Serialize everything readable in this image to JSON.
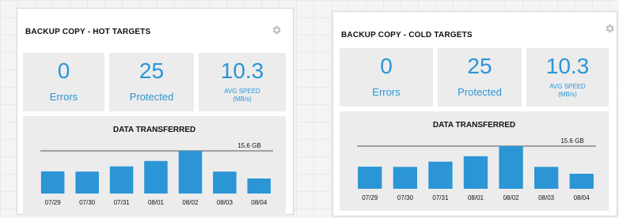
{
  "panels": [
    {
      "title": "BACKUP COPY - HOT TARGETS",
      "stats": {
        "errors": {
          "value": "0",
          "label": "Errors"
        },
        "protected": {
          "value": "25",
          "label": "Protected"
        },
        "speed": {
          "value": "10.3",
          "label_line1": "AVG SPEED",
          "label_line2": "(MB/s)"
        }
      },
      "chart_data": {
        "type": "bar",
        "title": "DATA TRANSFERRED",
        "categories": [
          "07/29",
          "07/30",
          "07/31",
          "08/01",
          "08/02",
          "08/03",
          "08/04"
        ],
        "values": [
          8.1,
          8.0,
          9.9,
          11.9,
          15.6,
          8.0,
          5.5
        ],
        "peak_label": "15.6 GB",
        "ylim": [
          0,
          15.6
        ],
        "bar_color": "#2b95d6",
        "highlight_index": 4
      }
    },
    {
      "title": "BACKUP COPY - COLD TARGETS",
      "stats": {
        "errors": {
          "value": "0",
          "label": "Errors"
        },
        "protected": {
          "value": "25",
          "label": "Protected"
        },
        "speed": {
          "value": "10.3",
          "label_line1": "AVG SPEED",
          "label_line2": "(MB/s)"
        }
      },
      "chart_data": {
        "type": "bar",
        "title": "DATA TRANSFERRED",
        "categories": [
          "07/29",
          "07/30",
          "07/31",
          "08/01",
          "08/02",
          "08/03",
          "08/04"
        ],
        "values": [
          8.1,
          8.0,
          9.9,
          11.9,
          15.6,
          8.0,
          5.5
        ],
        "peak_label": "15.6 GB",
        "ylim": [
          0,
          15.6
        ],
        "bar_color": "#2b95d6",
        "highlight_index": 4
      }
    }
  ],
  "colors": {
    "accent": "#2b95d6",
    "gear": "#bdbdbd"
  },
  "icons": {
    "settings": "gear-icon"
  }
}
